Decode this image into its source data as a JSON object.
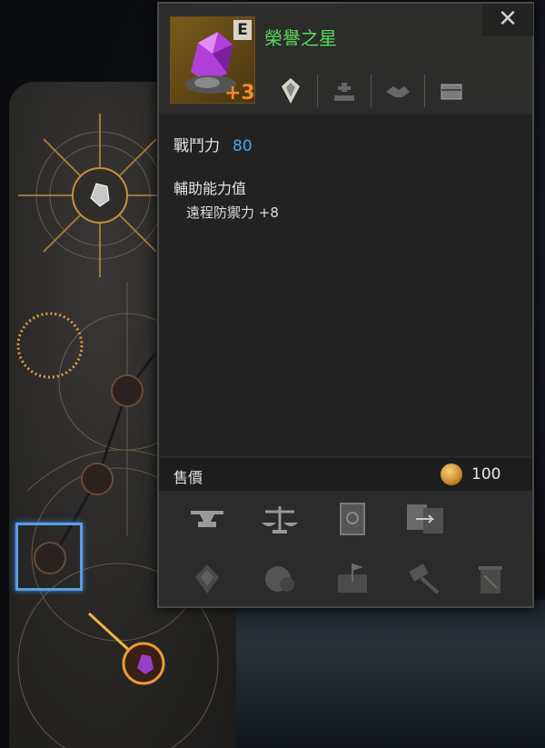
{
  "item": {
    "name": "榮譽之星",
    "grade": "E",
    "enhance": "+3",
    "icon": "purple-crystal-icon"
  },
  "close_label": "✕",
  "tags": [
    "card-icon",
    "grave-icon",
    "handshake-icon",
    "chest-icon"
  ],
  "stats": {
    "combat_power_label": "戰鬥力",
    "combat_power_value": "80"
  },
  "sub_stats": {
    "heading": "輔助能力值",
    "lines": [
      "遠程防禦力 +8"
    ]
  },
  "price": {
    "label": "售價",
    "value": "100"
  },
  "actions": {
    "row1": [
      "anvil-icon",
      "scales-icon",
      "book-icon",
      "exchange-icon"
    ],
    "row2": [
      "crystal-icon",
      "sphere-icon",
      "map-flag-icon",
      "hammer-icon",
      "trash-icon"
    ]
  },
  "colors": {
    "item_name": "#5ad85a",
    "combat_value": "#4aa6ea",
    "enhance": "#f28a2c",
    "selector": "#5a9de6"
  }
}
